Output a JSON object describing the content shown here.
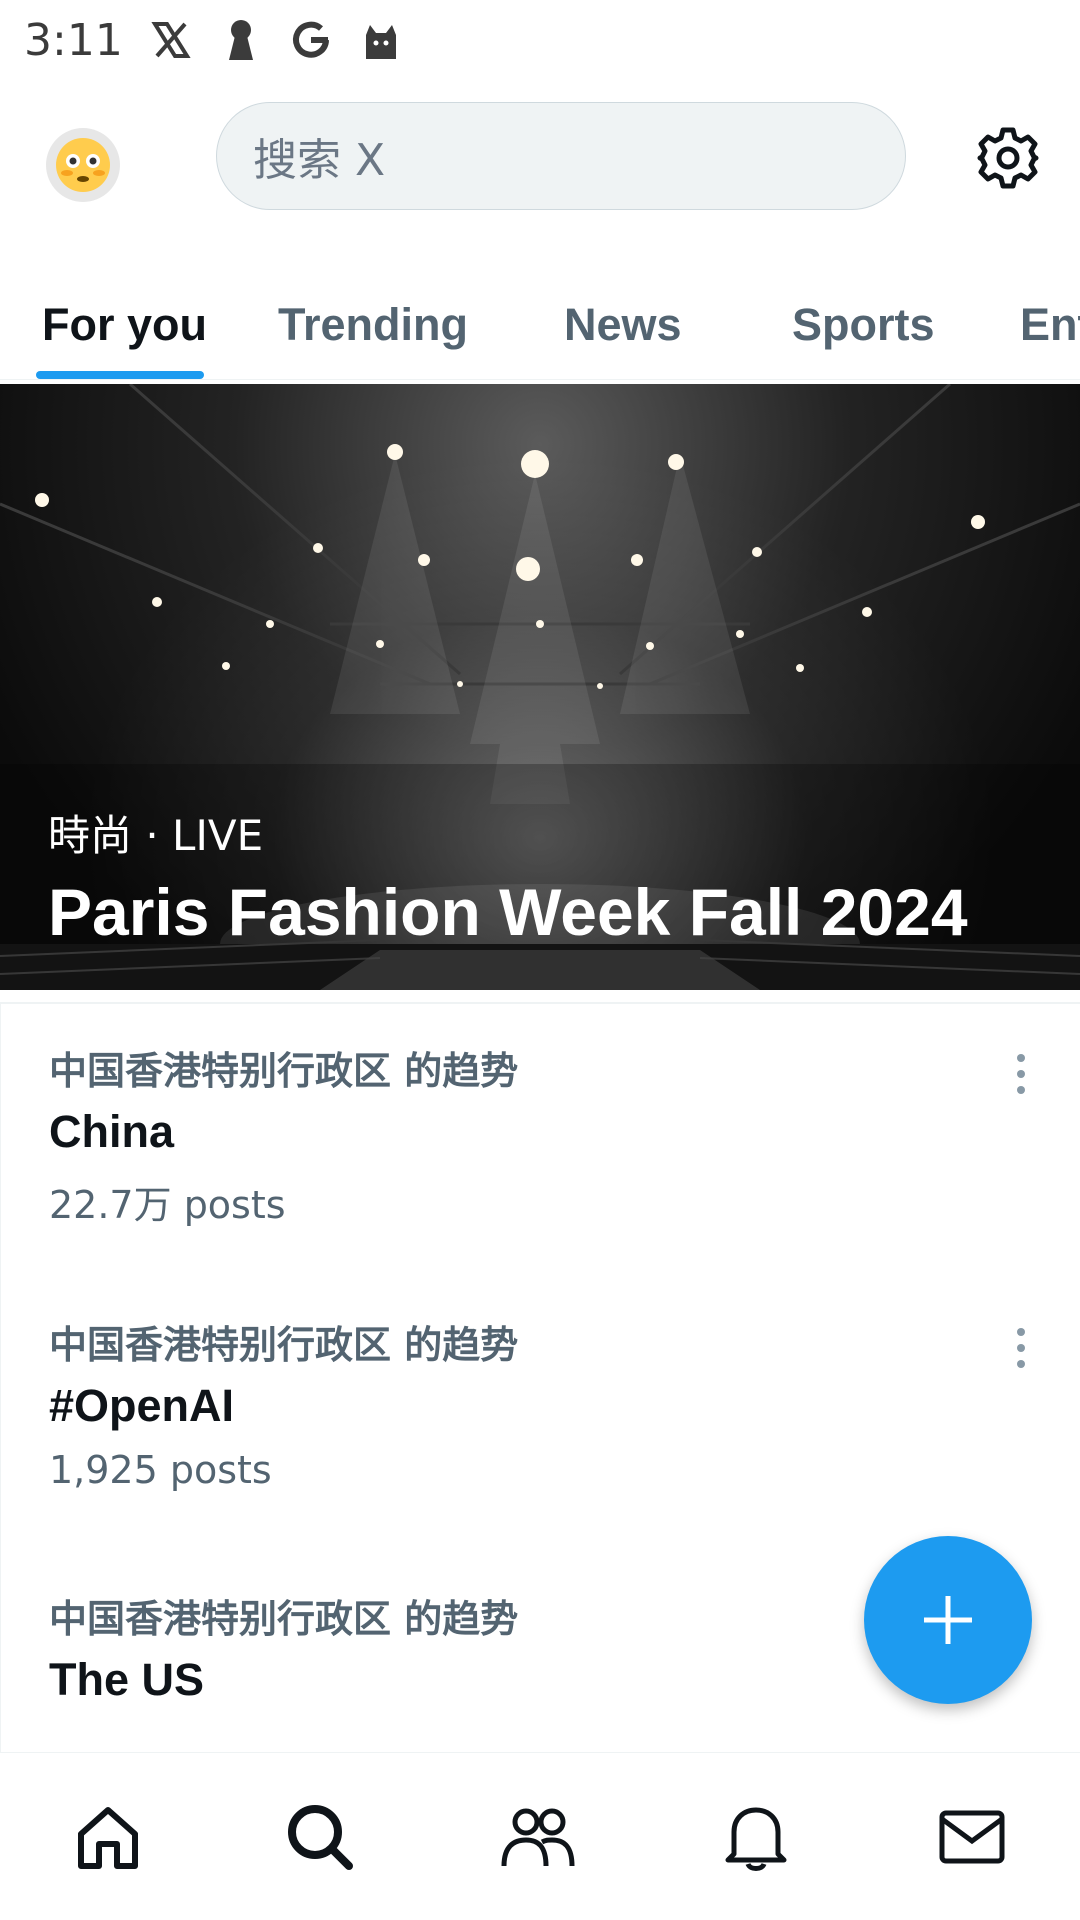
{
  "status_bar": {
    "time": "3:11",
    "icons": [
      "x-logo-icon",
      "keyhole-icon",
      "google-icon",
      "cat-icon"
    ]
  },
  "header": {
    "avatar_icon": "flushed-face-emoji-icon",
    "search_placeholder": "搜索 X",
    "settings_icon": "gear-icon"
  },
  "tabs": [
    {
      "label": "For you",
      "active": true
    },
    {
      "label": "Trending",
      "active": false
    },
    {
      "label": "News",
      "active": false
    },
    {
      "label": "Sports",
      "active": false
    },
    {
      "label": "Ent",
      "active": false
    }
  ],
  "hero": {
    "kicker": "時尚 · LIVE",
    "title": "Paris Fashion Week Fall 2024"
  },
  "trends": [
    {
      "context": "中国香港特别行政区 的趋势",
      "name": "China",
      "posts": "22.7万 posts"
    },
    {
      "context": "中国香港特别行政区 的趋势",
      "name": "#OpenAI",
      "posts": "1,925 posts"
    },
    {
      "context": "中国香港特别行政区 的趋势",
      "name": "The US",
      "posts": ""
    }
  ],
  "fab": {
    "icon": "plus-icon"
  },
  "bottom_nav": [
    {
      "icon": "home-icon"
    },
    {
      "icon": "search-icon"
    },
    {
      "icon": "communities-icon"
    },
    {
      "icon": "bell-icon"
    },
    {
      "icon": "mail-icon"
    }
  ],
  "colors": {
    "accent": "#1d9bf0",
    "text_primary": "#0f1419",
    "text_secondary": "#536471"
  }
}
